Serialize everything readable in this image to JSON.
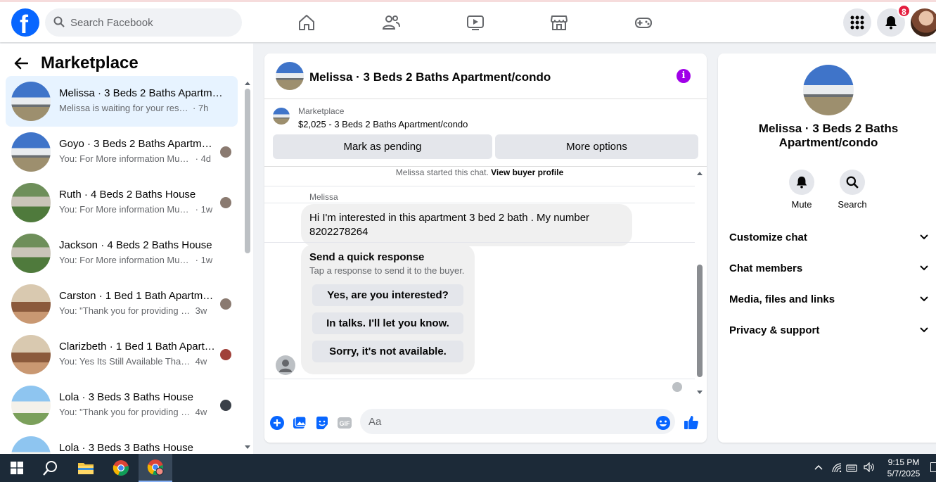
{
  "topbar": {
    "logo_letter": "f",
    "search_placeholder": "Search Facebook",
    "notification_count": "8"
  },
  "sidebar": {
    "title": "Marketplace",
    "conversations": [
      {
        "name": "Melissa · 3 Beds 2 Baths Apartm…",
        "preview": "Melissa is waiting for your response.",
        "time": "· 7h",
        "active": true,
        "thumb": "house"
      },
      {
        "name": "Goyo · 3 Beds 2 Baths Apartm…",
        "preview": "You: For More information Must…",
        "time": "· 4d",
        "active": false,
        "thumb": "house"
      },
      {
        "name": "Ruth · 4 Beds 2 Baths House",
        "preview": "You: For More information Must…",
        "time": "· 1w",
        "active": false,
        "thumb": "green"
      },
      {
        "name": "Jackson · 4 Beds 2 Baths House",
        "preview": "You: For More information Must se…",
        "time": "· 1w",
        "active": false,
        "thumb": "green"
      },
      {
        "name": "Carston · 1 Bed 1 Bath Apartm…",
        "preview": "You: \"Thank you for providing y…",
        "time": "3w",
        "active": false,
        "thumb": "room"
      },
      {
        "name": "Clarizbeth · 1 Bed 1 Bath Apart…",
        "preview": "You: Yes Its Still Available Thanks…",
        "time": "4w",
        "active": false,
        "thumb": "room"
      },
      {
        "name": "Lola · 3 Beds 3 Baths House",
        "preview": "You: \"Thank you for providing y…",
        "time": "4w",
        "active": false,
        "thumb": "blue"
      },
      {
        "name": "Lola · 3 Beds 3 Baths House",
        "preview": "",
        "time": "",
        "active": false,
        "thumb": "blue"
      }
    ]
  },
  "chat": {
    "title": "Melissa · 3 Beds 2 Baths Apartment/condo",
    "listing_source": "Marketplace",
    "listing_desc": "$2,025 - 3 Beds 2 Baths Apartment/condo",
    "mark_pending": "Mark as pending",
    "more_options": "More options",
    "started_text": "Melissa started this chat.",
    "view_profile": "View buyer profile",
    "sender": "Melissa",
    "message": "Hi I'm interested in this apartment 3 bed 2 bath . My number 8202278264",
    "quick_title": "Send a quick response",
    "quick_sub": "Tap a response to send it to the buyer.",
    "quick_replies": [
      "Yes, are you interested?",
      "In talks. I'll let you know.",
      "Sorry, it's not available."
    ],
    "composer_placeholder": "Aa"
  },
  "details": {
    "title": "Melissa · 3 Beds 2 Baths Apartment/condo",
    "mute": "Mute",
    "search": "Search",
    "sections": [
      "Customize chat",
      "Chat members",
      "Media, files and links",
      "Privacy & support"
    ]
  },
  "taskbar": {
    "time": "9:15 PM",
    "date": "5/7/2025"
  },
  "colors": {
    "brand": "#0866ff",
    "active_conv": "#e7f3ff",
    "info": "#a000e8",
    "badge": "#e41e3f",
    "taskbar": "#1c2a38"
  }
}
